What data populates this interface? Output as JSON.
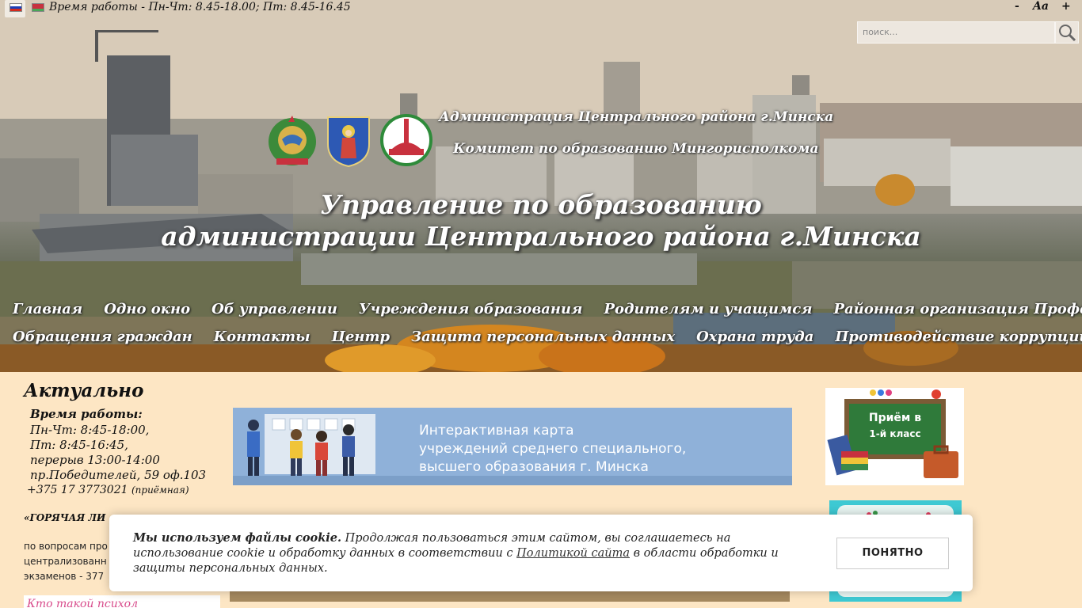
{
  "topbar": {
    "flags": [
      "Русский",
      "Беларуская"
    ],
    "work_hours": "Время работы - Пн-Чт: 8.45-18.00; Пт: 8.45-16.45",
    "font_decrease": "-",
    "font_label": "Aa",
    "font_increase": "+"
  },
  "search": {
    "placeholder": "поиск..."
  },
  "header": {
    "org_line1": "Администрация Центрального района г.Минска",
    "org_line2": "Комитет по образованию Мингорисполкома",
    "title_line1": "Управление по образованию",
    "title_line2": "администрации Центрального района г.Минска"
  },
  "nav": {
    "row1": [
      "Главная",
      "Одно окно",
      "Об управлении",
      "Учреждения образования",
      "Родителям и учащимся",
      "Районная организация Профсоюза"
    ],
    "row2": [
      "Обращения граждан",
      "Контакты",
      "Центр",
      "Защита персональных данных",
      "Охрана труда",
      "Противодействие коррупции"
    ]
  },
  "left": {
    "title": "Актуально",
    "work_hours_title": "Время работы:",
    "work_hours_lines": [
      "Пн-Чт: 8:45-18:00,",
      "Пт: 8:45-16:45,",
      "перерыв 13:00-14:00",
      "пр.Победителей, 59 оф.103"
    ],
    "phone": "+375 17 3773021",
    "phone_note": "(приёмная)",
    "hotline": "«ГОРЯЧАЯ ЛИ",
    "hotline_lines": [
      "по вопросам про",
      "централизованн",
      "экзаменов - 377"
    ],
    "banner_text": "Кто такой психол"
  },
  "map_banner": {
    "lines": [
      "Интерактивная карта",
      "учреждений среднего специального,",
      "высшего образования г. Минска"
    ]
  },
  "right_banner": {
    "line1": "Приём в",
    "line2": "1-й класс"
  },
  "cookie": {
    "bold": "Мы используем файлы cookie.",
    "text_a": " Продолжая пользоваться этим сайтом, вы соглашаетесь на использование cookie и обработку данных в соответствии с ",
    "link": "Политикой сайта",
    "text_b": " в области обработки и защиты персональных данных.",
    "button": "ПОНЯТНО"
  },
  "colors": {
    "page_bg": "#fde6c4",
    "map_banner": "#8fb1d9",
    "right_banner2": "#3ec9d3"
  }
}
